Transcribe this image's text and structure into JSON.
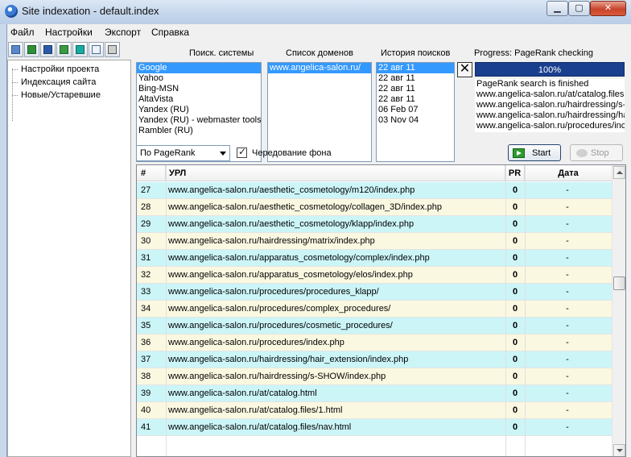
{
  "window": {
    "title": "Site indexation - default.index",
    "minimize": "▁",
    "maximize": "▢",
    "close": "✕"
  },
  "menu": [
    "Файл",
    "Настройки",
    "Экспорт",
    "Справка"
  ],
  "toolbar_icons": [
    "open-file-icon",
    "excel-export-icon",
    "word-export-icon",
    "excel-alt-export-icon",
    "copy-icon",
    "html-export-icon",
    "print-icon"
  ],
  "tree": [
    "Настройки проекта",
    "Индексация сайта",
    "Новые/Устаревшие"
  ],
  "search_engines": {
    "label": "Поиск. системы",
    "items": [
      "Google",
      "Yahoo",
      "Bing-MSN",
      "AltaVista",
      "Yandex (RU)",
      "Yandex (RU) - webmaster tools",
      "Rambler (RU)"
    ],
    "selected": 0
  },
  "domains": {
    "label": "Список доменов",
    "items": [
      "www.angelica-salon.ru/"
    ],
    "selected": 0
  },
  "history": {
    "label": "История поисков",
    "items": [
      "22 авг 11",
      "22 авг 11",
      "22 авг 11",
      "22 авг 11",
      "06 Feb 07",
      "03 Nov 04"
    ],
    "selected": 0
  },
  "progress": {
    "label": "Progress: PageRank checking",
    "value_text": "100%",
    "fraction": 1.0
  },
  "log": [
    "PageRank search is finished",
    "www.angelica-salon.ru/at/catalog.files",
    "www.angelica-salon.ru/hairdressing/s-",
    "www.angelica-salon.ru/hairdressing/ha",
    "www.angelica-salon.ru/procedures/inc"
  ],
  "controls": {
    "sort_value": "По PageRank",
    "alternate_bg_label": "Чередование фона",
    "alternate_bg_checked": true,
    "start_label": "Start",
    "stop_label": "Stop"
  },
  "table": {
    "headers": [
      "#",
      "УРЛ",
      "PR",
      "Дата"
    ],
    "rows": [
      [
        "27",
        "www.angelica-salon.ru/aesthetic_cosmetology/m120/index.php",
        "0",
        "-"
      ],
      [
        "28",
        "www.angelica-salon.ru/aesthetic_cosmetology/collagen_3D/index.php",
        "0",
        "-"
      ],
      [
        "29",
        "www.angelica-salon.ru/aesthetic_cosmetology/klapp/index.php",
        "0",
        "-"
      ],
      [
        "30",
        "www.angelica-salon.ru/hairdressing/matrix/index.php",
        "0",
        "-"
      ],
      [
        "31",
        "www.angelica-salon.ru/apparatus_cosmetology/complex/index.php",
        "0",
        "-"
      ],
      [
        "32",
        "www.angelica-salon.ru/apparatus_cosmetology/elos/index.php",
        "0",
        "-"
      ],
      [
        "33",
        "www.angelica-salon.ru/procedures/procedures_klapp/",
        "0",
        "-"
      ],
      [
        "34",
        "www.angelica-salon.ru/procedures/complex_procedures/",
        "0",
        "-"
      ],
      [
        "35",
        "www.angelica-salon.ru/procedures/cosmetic_procedures/",
        "0",
        "-"
      ],
      [
        "36",
        "www.angelica-salon.ru/procedures/index.php",
        "0",
        "-"
      ],
      [
        "37",
        "www.angelica-salon.ru/hairdressing/hair_extension/index.php",
        "0",
        "-"
      ],
      [
        "38",
        "www.angelica-salon.ru/hairdressing/s-SHOW/index.php",
        "0",
        "-"
      ],
      [
        "39",
        "www.angelica-salon.ru/at/catalog.html",
        "0",
        "-"
      ],
      [
        "40",
        "www.angelica-salon.ru/at/catalog.files/1.html",
        "0",
        "-"
      ],
      [
        "41",
        "www.angelica-salon.ru/at/catalog.files/nav.html",
        "0",
        "-"
      ]
    ]
  },
  "colors": {
    "row_odd": "#ccf5f8",
    "row_even": "#fbf8e1",
    "selection": "#3399ff",
    "progress_fill": "#1a3f8f"
  }
}
